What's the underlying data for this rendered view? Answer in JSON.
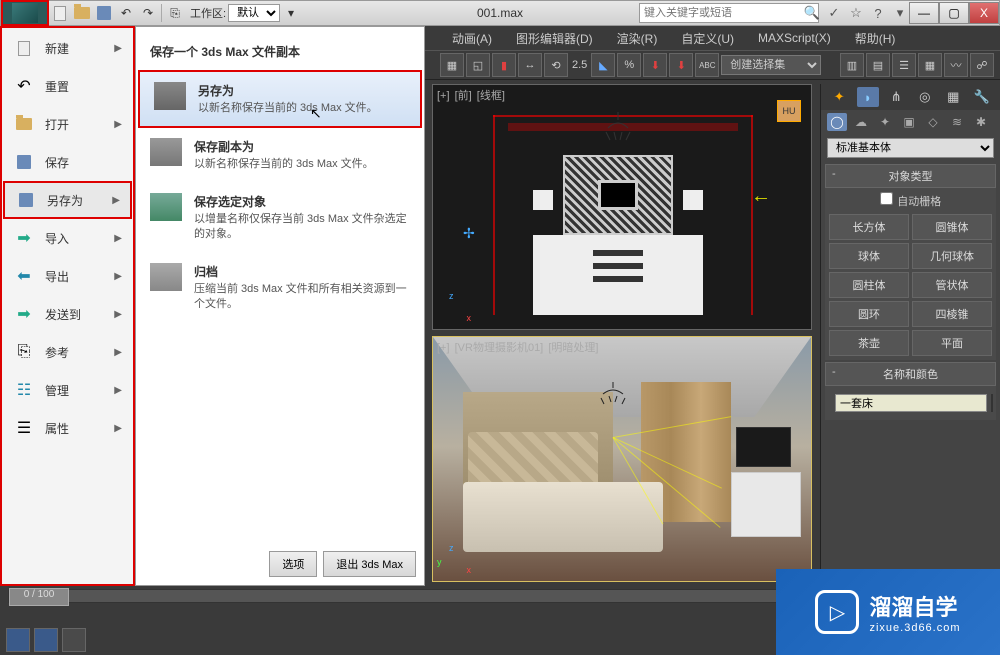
{
  "filename": "001.max",
  "search_placeholder": "键入关键字或短语",
  "workspace": {
    "label": "工作区:",
    "value": "默认"
  },
  "window_controls": {
    "min": "—",
    "max": "▢",
    "close": "X"
  },
  "menubar": [
    "动画(A)",
    "图形编辑器(D)",
    "渲染(R)",
    "自定义(U)",
    "MAXScript(X)",
    "帮助(H)"
  ],
  "shelf": {
    "spinner": "2.5",
    "select_placeholder": "创建选择集"
  },
  "app_menu": {
    "items": [
      {
        "label": "新建",
        "arrow": true
      },
      {
        "label": "重置",
        "arrow": false
      },
      {
        "label": "打开",
        "arrow": true
      },
      {
        "label": "保存",
        "arrow": false
      },
      {
        "label": "另存为",
        "arrow": true,
        "highlighted": true
      },
      {
        "label": "导入",
        "arrow": true
      },
      {
        "label": "导出",
        "arrow": true
      },
      {
        "label": "发送到",
        "arrow": true
      },
      {
        "label": "参考",
        "arrow": true
      },
      {
        "label": "管理",
        "arrow": true
      },
      {
        "label": "属性",
        "arrow": true
      }
    ]
  },
  "submenu": {
    "title": "保存一个 3ds Max 文件副本",
    "items": [
      {
        "title": "另存为",
        "desc": "以新名称保存当前的 3ds Max 文件。",
        "highlighted": true
      },
      {
        "title": "保存副本为",
        "desc": "以新名称保存当前的 3ds Max 文件。"
      },
      {
        "title": "保存选定对象",
        "desc": "以增量名称仅保存当前 3ds Max 文件杂选定的对象。"
      },
      {
        "title": "归档",
        "desc": "压缩当前 3ds Max 文件和所有相关资源到一个文件。"
      }
    ],
    "footer": {
      "options": "选项",
      "exit": "退出 3ds Max"
    }
  },
  "viewports": {
    "vp1": {
      "labels": [
        "[+]",
        "[前]",
        "[线框]"
      ],
      "orange_label": "HU"
    },
    "vp2": {
      "labels": [
        "[+]",
        "[VR物理摄影机01]",
        "[明暗处理]"
      ]
    }
  },
  "cmd_panel": {
    "dropdown": "标准基本体",
    "rollout_objtype": {
      "title": "对象类型",
      "autogrid": "自动栅格",
      "buttons": [
        "长方体",
        "圆锥体",
        "球体",
        "几何球体",
        "圆柱体",
        "管状体",
        "圆环",
        "四棱锥",
        "茶壶",
        "平面"
      ]
    },
    "rollout_name": {
      "title": "名称和颜色",
      "value": "一套床"
    }
  },
  "timeline": {
    "handle": "0 / 100"
  },
  "watermark": {
    "main": "溜溜自学",
    "sub": "zixue.3d66.com"
  }
}
